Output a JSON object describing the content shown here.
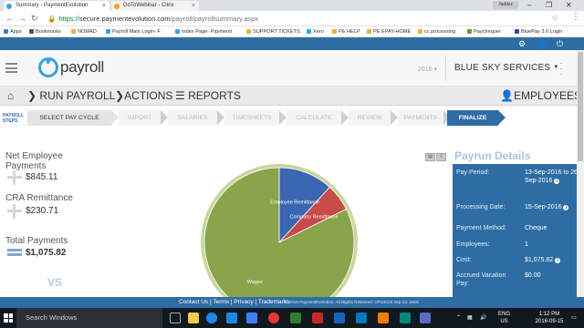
{
  "browser": {
    "tabs": [
      {
        "label": "Summary - PaymentEvolution",
        "active": true
      },
      {
        "label": "GoToWebinar - Citrix",
        "active": false
      }
    ],
    "user": "Jaddzz",
    "url_secure": "https://",
    "url_host": "secure.paymentevolution.com",
    "url_path": "/payroll/payrollsummary.aspx",
    "bookmarks": [
      "Apps",
      "Bookmarks",
      "NOMAD",
      "Payroll Main Login- F",
      "Index Page- Paymenti",
      "SUPPORT TICKETS",
      "Xero",
      "PE HELP",
      "PE EPAY-HOME",
      "cc processing",
      "Paychequer",
      "BluePay 3.0 Login"
    ]
  },
  "header": {
    "logo_text": "payroll",
    "year": "2016",
    "company": "BLUE SKY SERVICES"
  },
  "nav": {
    "run_payroll": "RUN PAYROLL",
    "actions": "ACTIONS",
    "reports": "REPORTS",
    "employees": "EMPLOYEES"
  },
  "steps": {
    "label": "PAYROLL STEPS",
    "items": [
      "SELECT PAY CYCLE",
      "IMPORT",
      "SALARIES",
      "TIMESHEETS",
      "CALCULATE",
      "REVIEW",
      "PAYMENTS",
      "FINALIZE"
    ]
  },
  "summary": {
    "net_employee_label": "Net Employee Payments",
    "net_employee_value": "$845.11",
    "cra_label": "CRA Remittance",
    "cra_value": "$230.71",
    "total_label": "Total Payments",
    "total_value": "$1,075.82",
    "vs": "VS"
  },
  "chart_data": {
    "type": "pie",
    "slices": [
      {
        "label": "Wages",
        "value": 1075.82,
        "color": "#8aa44b"
      },
      {
        "label": "Employee Remittance",
        "value": 154.0,
        "color": "#3b66b1"
      },
      {
        "label": "Company Remittance",
        "value": 76.71,
        "color": "#c84a49"
      }
    ]
  },
  "details": {
    "title": "Payrun Details",
    "rows": [
      {
        "key": "Pay Period:",
        "value": "13-Sep-2016 to 26-Sep-2016",
        "info": true
      },
      {
        "key": "Processing Date:",
        "value": "15-Sep-2016",
        "info": true
      },
      {
        "key": "Payment Method:",
        "value": "Cheque",
        "info": false
      },
      {
        "key": "Employees:",
        "value": "1",
        "info": false
      },
      {
        "key": "Cost:",
        "value": "$1,075.82",
        "info": true
      },
      {
        "key": "Accrued Vacation Pay:",
        "value": "$0.00",
        "info": false
      }
    ]
  },
  "footer": {
    "contact": "Contact Us",
    "terms": "Terms",
    "privacy": "Privacy",
    "trademarks": "Trademarks",
    "copyright": "© 2016 PaymentEvolution. All Rights Reserved. UPS4019 Sep 13, 2016"
  },
  "taskbar": {
    "search_placeholder": "Search Windows",
    "lang": "ENG",
    "region": "US",
    "time": "1:12 PM",
    "date": "2016-09-15"
  }
}
